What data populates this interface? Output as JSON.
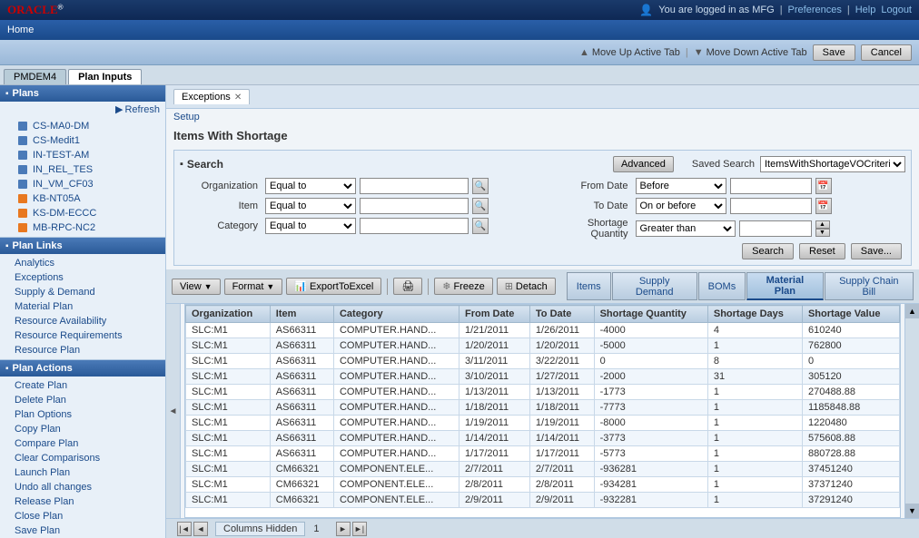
{
  "topbar": {
    "logo": "ORACLE",
    "logged_in_text": "You are logged in as MFG",
    "preferences": "Preferences",
    "help": "Help",
    "logout": "Logout"
  },
  "navbar": {
    "home": "Home"
  },
  "actionbar": {
    "move_up_tab": "Move Up Active Tab",
    "move_down_tab": "Move Down Active Tab",
    "save": "Save",
    "cancel": "Cancel"
  },
  "tabs": [
    {
      "id": "pmdem4",
      "label": "PMDEM4"
    },
    {
      "id": "plan-inputs",
      "label": "Plan Inputs"
    }
  ],
  "sidebar": {
    "plans_section": "Plans",
    "refresh": "Refresh",
    "plan_items": [
      {
        "id": "cs-ma0-dm",
        "label": "CS-MA0-DM",
        "type": "blue"
      },
      {
        "id": "cs-medit1",
        "label": "CS-Medit1",
        "type": "blue"
      },
      {
        "id": "in-test-am",
        "label": "IN-TEST-AM",
        "type": "blue"
      },
      {
        "id": "in-rel-tes",
        "label": "IN_REL_TES",
        "type": "blue"
      },
      {
        "id": "in-vm-cf03",
        "label": "IN_VM_CF03",
        "type": "blue"
      },
      {
        "id": "kb-nt05a",
        "label": "KB-NT05A",
        "type": "orange"
      },
      {
        "id": "ks-dm-eccc",
        "label": "KS-DM-ECCC",
        "type": "orange"
      },
      {
        "id": "mb-rpc-nc2",
        "label": "MB-RPC-NC2",
        "type": "orange"
      }
    ],
    "plan_links_section": "Plan Links",
    "plan_links_items": [
      {
        "id": "analytics",
        "label": "Analytics"
      },
      {
        "id": "exceptions",
        "label": "Exceptions"
      },
      {
        "id": "supply-demand",
        "label": "Supply & Demand"
      },
      {
        "id": "material-plan",
        "label": "Material Plan"
      },
      {
        "id": "resource-availability",
        "label": "Resource Availability"
      },
      {
        "id": "resource-requirements",
        "label": "Resource Requirements"
      },
      {
        "id": "resource-plan",
        "label": "Resource Plan"
      }
    ],
    "plan_actions_section": "Plan Actions",
    "plan_actions_items": [
      {
        "id": "create-plan",
        "label": "Create Plan"
      },
      {
        "id": "delete-plan",
        "label": "Delete Plan"
      },
      {
        "id": "plan-options",
        "label": "Plan Options"
      },
      {
        "id": "copy-plan",
        "label": "Copy Plan"
      },
      {
        "id": "compare-plan",
        "label": "Compare Plan"
      },
      {
        "id": "clear-comparisons",
        "label": "Clear Comparisons"
      },
      {
        "id": "launch-plan",
        "label": "Launch Plan"
      },
      {
        "id": "undo-all-changes",
        "label": "Undo all changes"
      },
      {
        "id": "release-plan",
        "label": "Release Plan"
      },
      {
        "id": "close-plan",
        "label": "Close Plan"
      },
      {
        "id": "save-plan",
        "label": "Save Plan"
      }
    ]
  },
  "exceptions": {
    "tab_label": "Exceptions",
    "setup_link": "Setup",
    "page_title": "Items With Shortage",
    "search": {
      "title": "Search",
      "advanced_btn": "Advanced",
      "saved_search_label": "Saved Search",
      "saved_search_value": "ItemsWithShortageVOCriteria",
      "org_label": "Organization",
      "org_operator": "Equal to",
      "item_label": "Item",
      "item_operator": "Equal to",
      "category_label": "Category",
      "category_operator": "Equal to",
      "from_date_label": "From Date",
      "from_date_operator": "Before",
      "to_date_label": "To Date",
      "to_date_operator": "On or before",
      "shortage_qty_label": "Shortage Quantity",
      "shortage_qty_operator": "Greater than",
      "search_btn": "Search",
      "reset_btn": "Reset",
      "save_btn": "Save..."
    },
    "toolbar": {
      "view_btn": "View",
      "format_btn": "Format",
      "export_btn": "ExportToExcel",
      "freeze_btn": "Freeze",
      "detach_btn": "Detach",
      "items_btn": "Items",
      "supply_demand_btn": "Supply Demand",
      "boms_btn": "BOMs",
      "material_plan_btn": "Material Plan",
      "supply_chain_bill_btn": "Supply Chain Bill"
    },
    "table": {
      "columns": [
        "Organization",
        "Item",
        "Category",
        "From Date",
        "To Date",
        "Shortage Quantity",
        "Shortage Days",
        "Shortage Value"
      ],
      "rows": [
        [
          "SLC:M1",
          "AS66311",
          "COMPUTER.HAND...",
          "1/21/2011",
          "1/26/2011",
          "-4000",
          "4",
          "610240"
        ],
        [
          "SLC:M1",
          "AS66311",
          "COMPUTER.HAND...",
          "1/20/2011",
          "1/20/2011",
          "-5000",
          "1",
          "762800"
        ],
        [
          "SLC:M1",
          "AS66311",
          "COMPUTER.HAND...",
          "3/11/2011",
          "3/22/2011",
          "0",
          "8",
          "0"
        ],
        [
          "SLC:M1",
          "AS66311",
          "COMPUTER.HAND...",
          "3/10/2011",
          "1/27/2011",
          "-2000",
          "31",
          "305120"
        ],
        [
          "SLC:M1",
          "AS66311",
          "COMPUTER.HAND...",
          "1/13/2011",
          "1/13/2011",
          "-1773",
          "1",
          "270488.88"
        ],
        [
          "SLC:M1",
          "AS66311",
          "COMPUTER.HAND...",
          "1/18/2011",
          "1/18/2011",
          "-7773",
          "1",
          "1185848.88"
        ],
        [
          "SLC:M1",
          "AS66311",
          "COMPUTER.HAND...",
          "1/19/2011",
          "1/19/2011",
          "-8000",
          "1",
          "1220480"
        ],
        [
          "SLC:M1",
          "AS66311",
          "COMPUTER.HAND...",
          "1/14/2011",
          "1/14/2011",
          "-3773",
          "1",
          "575608.88"
        ],
        [
          "SLC:M1",
          "AS66311",
          "COMPUTER.HAND...",
          "1/17/2011",
          "1/17/2011",
          "-5773",
          "1",
          "880728.88"
        ],
        [
          "SLC:M1",
          "CM66321",
          "COMPONENT.ELE...",
          "2/7/2011",
          "2/7/2011",
          "-936281",
          "1",
          "37451240"
        ],
        [
          "SLC:M1",
          "CM66321",
          "COMPONENT.ELE...",
          "2/8/2011",
          "2/8/2011",
          "-934281",
          "1",
          "37371240"
        ],
        [
          "SLC:M1",
          "CM66321",
          "COMPONENT.ELE...",
          "2/9/2011",
          "2/9/2011",
          "-932281",
          "1",
          "37291240"
        ]
      ]
    },
    "status": {
      "columns_hidden": "Columns Hidden",
      "page": "1"
    }
  }
}
